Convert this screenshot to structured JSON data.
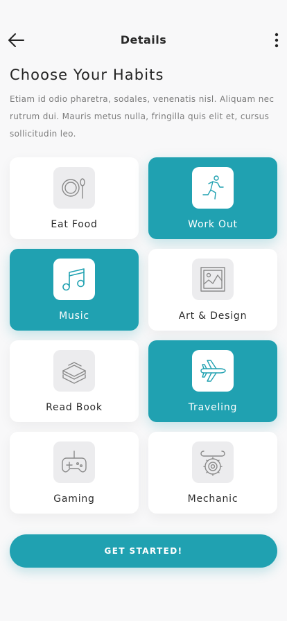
{
  "header": {
    "title": "Details",
    "back_icon": "arrow-left-icon",
    "more_icon": "more-vertical-icon"
  },
  "intro": {
    "heading": "Choose Your Habits",
    "description": "Etiam id odio pharetra, sodales, venenatis nisl. Aliquam nec rutrum dui. Mauris metus nulla, fringilla quis elit et, cursus sollicitudin leo."
  },
  "habits": [
    {
      "label": "Eat Food",
      "icon": "plate-spoon-icon",
      "selected": false
    },
    {
      "label": "Work Out",
      "icon": "running-person-icon",
      "selected": true
    },
    {
      "label": "Music",
      "icon": "music-note-icon",
      "selected": true
    },
    {
      "label": "Art & Design",
      "icon": "picture-frame-icon",
      "selected": false
    },
    {
      "label": "Read Book",
      "icon": "book-stack-icon",
      "selected": false
    },
    {
      "label": "Traveling",
      "icon": "airplane-icon",
      "selected": true
    },
    {
      "label": "Gaming",
      "icon": "gamepad-icon",
      "selected": false
    },
    {
      "label": "Mechanic",
      "icon": "wrench-gear-icon",
      "selected": false
    }
  ],
  "cta": {
    "label": "GET STARTED!"
  },
  "colors": {
    "accent": "#20a1b1",
    "icon_gray": "#8a8a8a",
    "card_bg": "#ffffff",
    "page_bg": "#f8f8f9"
  }
}
